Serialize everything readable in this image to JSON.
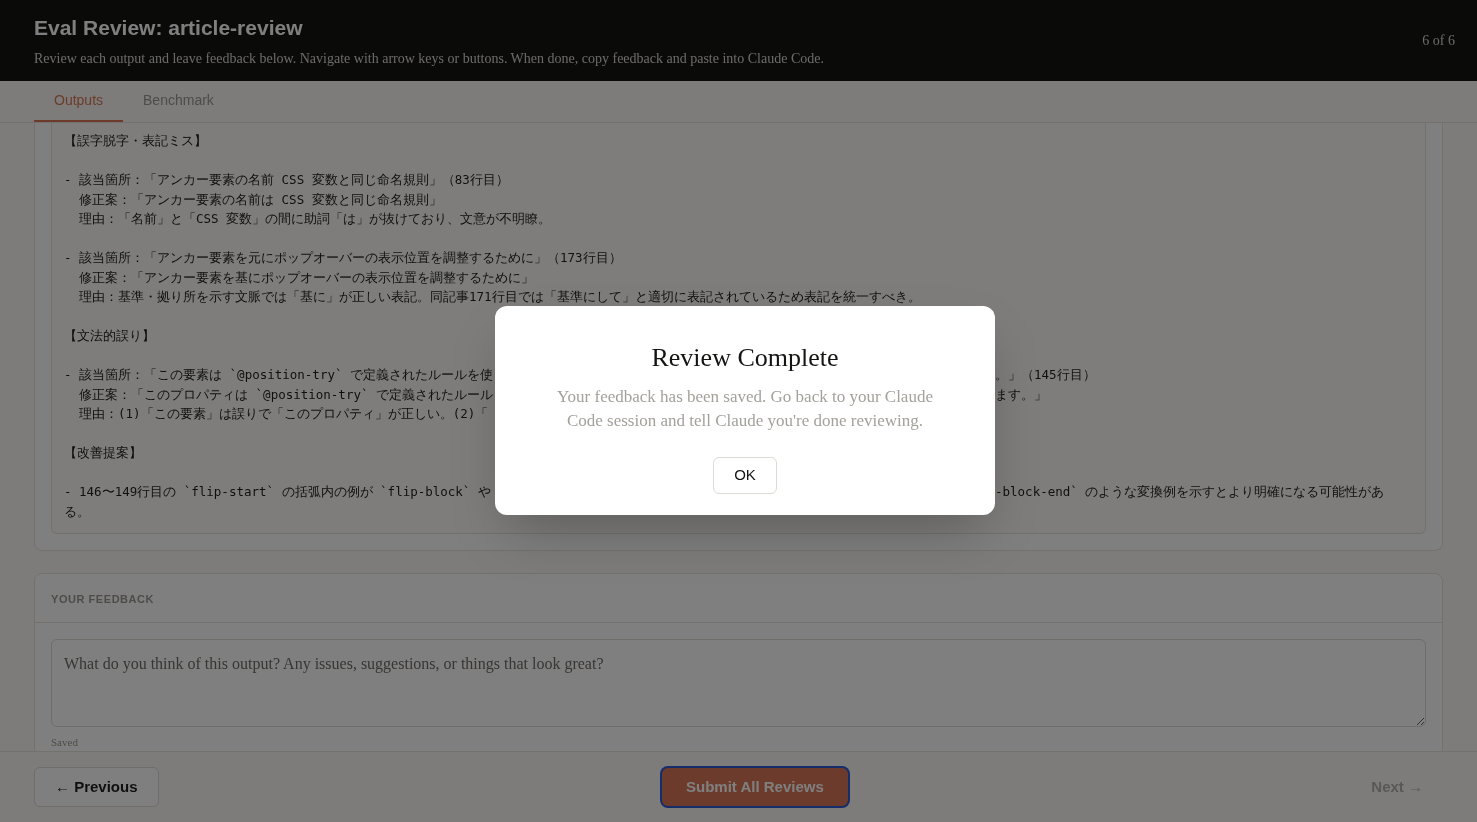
{
  "header": {
    "title": "Eval Review: article-review",
    "subtitle": "Review each output and leave feedback below. Navigate with arrow keys or buttons. When done, copy feedback and paste into Claude Code.",
    "counter": "6 of 6"
  },
  "tabs": [
    {
      "label": "Outputs",
      "selected": true
    },
    {
      "label": "Benchmark",
      "selected": false
    }
  ],
  "output_blocks": [
    [
      {
        "left": "【誤字脱字・表記ミス】"
      }
    ],
    [
      {
        "left": "- 該当箇所：「アンカー要素の名前 CSS 変数と同じ命名規則」（83行目）"
      },
      {
        "left": "  修正案：「アンカー要素の名前は CSS 変数と同じ命名規則」"
      },
      {
        "left": "  理由：「名前」と「CSS 変数」の間に助詞「は」が抜けており、文意が不明瞭。"
      }
    ],
    [
      {
        "left": "- 該当箇所：「アンカー要素を元にポップオーバーの表示位置を調整するために」（173行目）"
      },
      {
        "left": "  修正案：「アンカー要素を基にポップオーバーの表示位置を調整するために」"
      },
      {
        "left": "  理由：基準・拠り所を示す文脈では「基に」が正しい表記。同記事171行目では「基準にして」と適切に表記されているため表記を統一すべき。"
      }
    ],
    [
      {
        "left": "【文法的誤り】"
      }
    ],
    [
      {
        "left": "- 該当箇所：「この要素は `@position-try` で定義されたルールを使",
        "right": "。」（145行目）"
      },
      {
        "left": "  修正案：「このプロパティは `@position-try` で定義されたルール",
        "right": "ます。」"
      },
      {
        "left": "  理由：(1)「この要素」は誤りで「このプロパティ」が正しい。(2)「"
      }
    ],
    [
      {
        "left": "【改善提案】"
      }
    ],
    [
      {
        "left": "- 146〜149行目の `flip-start` の括弧内の例が `flip-block` や",
        "right": "-block-end` のような変換例を示すとより明確になる可能性があ"
      },
      {
        "left": "る。"
      }
    ]
  ],
  "feedback": {
    "heading": "YOUR FEEDBACK",
    "placeholder": "What do you think of this output? Any issues, suggestions, or things that look great?",
    "status": "Saved"
  },
  "footer": {
    "previous": {
      "label": "← Previous",
      "disabled": false
    },
    "submit": {
      "label": "Submit All Reviews"
    },
    "next": {
      "label": "Next →",
      "disabled": true
    }
  },
  "dialog": {
    "title": "Review Complete",
    "message": "Your feedback has been saved. Go back to your Claude Code session and tell Claude you're done reviewing.",
    "button": "OK"
  }
}
